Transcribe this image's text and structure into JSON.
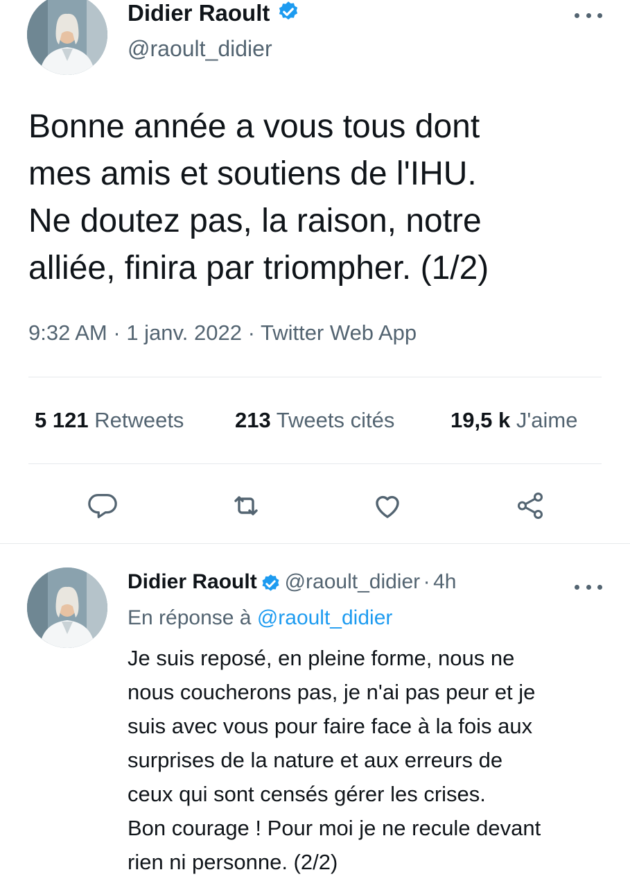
{
  "tweet": {
    "author_name": "Didier Raoult",
    "author_handle": "@raoult_didier",
    "text": "Bonne année a vous tous dont\nmes amis et soutiens de l'IHU.\nNe doutez pas, la raison, notre\nalliée, finira par triompher. (1/2)",
    "time": "9:32 AM",
    "date": "1 janv. 2022",
    "source": "Twitter Web App",
    "separator": "·",
    "stats": {
      "retweets_count": "5 121",
      "retweets_label": "Retweets",
      "quotes_count": "213",
      "quotes_label": "Tweets cités",
      "likes_count": "19,5 k",
      "likes_label": "J'aime"
    }
  },
  "reply": {
    "author_name": "Didier Raoult",
    "author_handle": "@raoult_didier",
    "age": "4h",
    "separator": "·",
    "in_reply_prefix": "En réponse à",
    "in_reply_handle": "@raoult_didier",
    "text": "Je suis reposé, en pleine forme, nous ne\nnous coucherons pas, je n'ai pas peur et je\nsuis avec vous pour faire face à la fois aux\nsurprises de la nature et aux erreurs de\nceux qui sont censés gérer les crises.\nBon courage ! Pour moi je ne recule devant\nrien ni personne. (2/2)"
  },
  "icons": [
    "verified-icon",
    "more-icon",
    "reply-icon",
    "retweet-icon",
    "like-icon",
    "share-icon"
  ],
  "colors": {
    "verified": "#1d9bf0",
    "text": "#0f1419",
    "secondary": "#536471",
    "link": "#1d9bf0",
    "divider": "#e6e9ec"
  }
}
